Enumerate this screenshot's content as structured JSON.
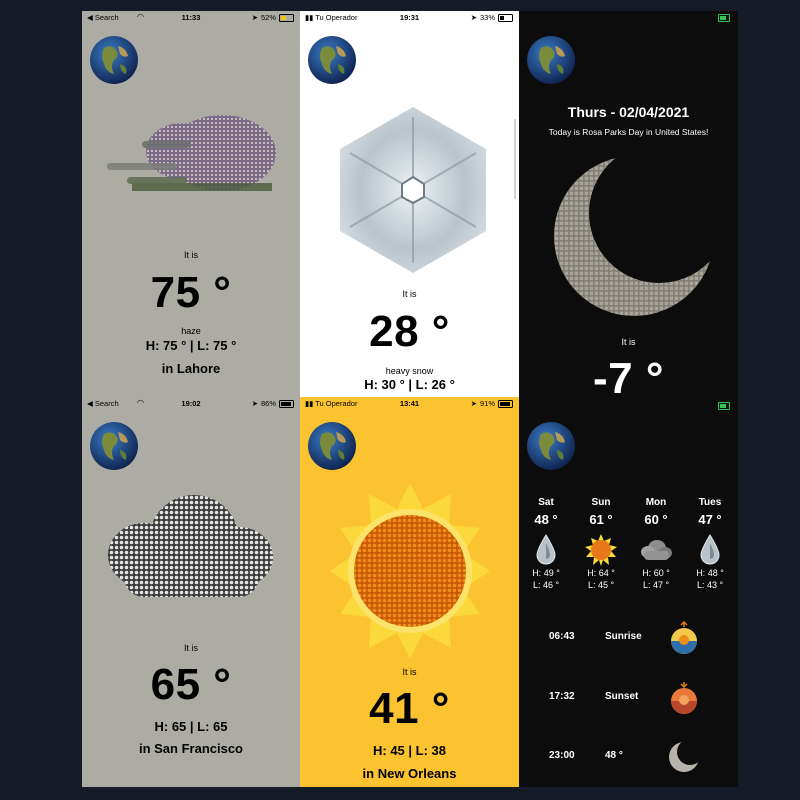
{
  "panels": [
    {
      "status": {
        "left": "◀ Search",
        "time": "11:33",
        "right": "52%"
      },
      "it_is": "It is",
      "temp": "75 °",
      "desc": "haze",
      "hilo": "H: 75 ° | L: 75 °",
      "city": "in Lahore"
    },
    {
      "status": {
        "left": "Tu Operador",
        "time": "19:31",
        "right": "33%"
      },
      "it_is": "It is",
      "temp": "28 °",
      "desc": "heavy snow",
      "hilo": "H: 30 ° | L: 26 °"
    },
    {
      "date_title": "Thurs - 02/04/2021",
      "holiday": "Today is Rosa Parks Day in United States!",
      "it_is": "It is",
      "temp": "-7 °"
    },
    {
      "status": {
        "left": "◀ Search",
        "time": "19:02",
        "right": "86%"
      },
      "it_is": "It is",
      "temp": "65 °",
      "hilo": "H: 65 | L: 65",
      "city": "in San Francisco"
    },
    {
      "status": {
        "left": "Tu Operador",
        "time": "13:41",
        "right": "91%"
      },
      "it_is": "It is",
      "temp": "41 °",
      "hilo": "H: 45 | L: 38",
      "city": "in New Orleans"
    },
    {
      "forecast": [
        {
          "day": "Sat",
          "temp": "48 °",
          "icon": "raindrop-icon",
          "hi": "H: 49 °",
          "lo": "L: 46 °"
        },
        {
          "day": "Sun",
          "temp": "61 °",
          "icon": "sun-icon",
          "hi": "H: 64 °",
          "lo": "L: 45 °"
        },
        {
          "day": "Mon",
          "temp": "60 °",
          "icon": "cloud-icon",
          "hi": "H: 60 °",
          "lo": "L: 47 °"
        },
        {
          "day": "Tues",
          "temp": "47 °",
          "icon": "raindrop-icon",
          "hi": "H: 48 °",
          "lo": "L: 43 °"
        }
      ],
      "sunrise": {
        "time": "06:43",
        "label": "Sunrise"
      },
      "sunset": {
        "time": "17:32",
        "label": "Sunset"
      },
      "night": {
        "time": "23:00",
        "temp": "48 °"
      }
    }
  ],
  "colors": {
    "gray_bg": "#adaca4",
    "white_bg": "#ffffff",
    "black_bg": "#0c0c0c",
    "yellow_bg": "#fbc32f",
    "page_bg": "#141a26",
    "battery_green": "#34c759"
  }
}
